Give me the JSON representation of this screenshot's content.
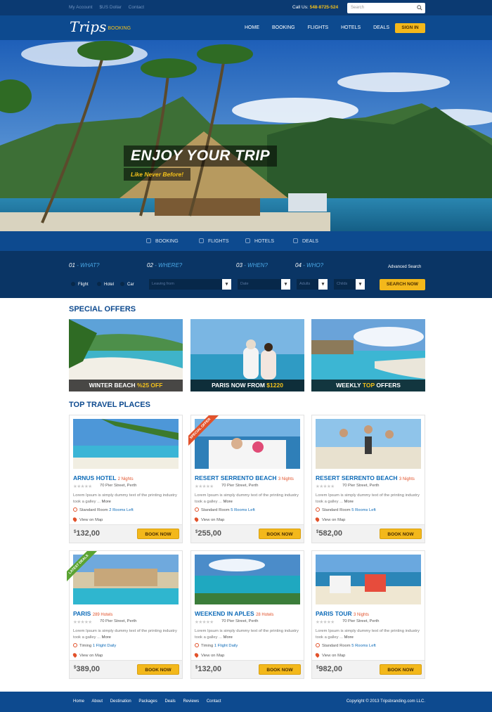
{
  "topbar": {
    "links": [
      "My Account",
      "$US Dollar",
      "Contact"
    ],
    "call_label": "Call Us:",
    "phone": "548-8725-524",
    "search_placeholder": "Search"
  },
  "header": {
    "logo": "Trips",
    "logo_sub": "BOOKING",
    "menu": [
      "HOME",
      "BOOKING",
      "FLIGHTS",
      "HOTELS",
      "DEALS"
    ],
    "signin": "SIGN IN"
  },
  "hero": {
    "title": "ENJOY YOUR TRIP",
    "subtitle": "Like Never Before!"
  },
  "tabs": [
    "BOOKING",
    "FLIGHTS",
    "HOTELS",
    "DEALS"
  ],
  "search_form": {
    "steps": [
      {
        "num": "01",
        "label": " - WHAT?"
      },
      {
        "num": "02",
        "label": " - WHERE?"
      },
      {
        "num": "03",
        "label": " - WHEN?"
      },
      {
        "num": "04",
        "label": " - WHO?"
      }
    ],
    "advanced": "Advanced Search",
    "types": [
      "Flight",
      "Hotel",
      "Car"
    ],
    "leaving_from": "Leaving from",
    "date": "Date",
    "adults": "Adults",
    "childs": "Childs",
    "button": "SEARCH NOW"
  },
  "special_offers": {
    "title": "SPECIAL OFFERS",
    "items": [
      {
        "pre": "WINTER BEACH ",
        "hl": "%25 OFF",
        "post": ""
      },
      {
        "pre": "PARIS NOW FROM ",
        "hl": "$1220",
        "post": ""
      },
      {
        "pre": "WEEKLY ",
        "hl": "TOP",
        "post": " OFFERS"
      }
    ]
  },
  "top_places": {
    "title": "TOP TRAVEL PLACES",
    "stars": "★★★★★",
    "desc": "Lorem Ipsum is simply dummy text of the printing industry took a galley ... ",
    "more": "More",
    "view_map": "View on Map",
    "book": "BOOK NOW",
    "currency": "$",
    "cards": [
      {
        "name": "ARNUS HOTEL",
        "nights": "2 Nights",
        "addr": "70 Pier Street, Perth",
        "room": "Standard Room",
        "room_hl": "2 Rooms Left",
        "price": "132,00",
        "ribbon": ""
      },
      {
        "name": "RESERT SERRENTO BEACH",
        "nights": "3 Nights",
        "addr": "70 Pier Street, Perth",
        "room": "Standard Room",
        "room_hl": "5 Rooms Left",
        "price": "255,00",
        "ribbon": "SPECIAL OFFER"
      },
      {
        "name": "RESERT SERRENTO BEACH",
        "nights": "3 Nights",
        "addr": "70 Pier Street, Perth",
        "room": "Standard Room",
        "room_hl": "5 Rooms Left",
        "price": "582,00",
        "ribbon": ""
      },
      {
        "name": "PARIS",
        "nights": "289 Hotels",
        "addr": "70 Pier Street, Perth",
        "room": "Timing",
        "room_hl": "1 Flight Daily",
        "price": "389,00",
        "ribbon": "LATEST DEALS"
      },
      {
        "name": "WEEKEND IN APLES",
        "nights": "28 Hotels",
        "addr": "70 Pier Street, Perth",
        "room": "Timing",
        "room_hl": "1 Flight Daily",
        "price": "132,00",
        "ribbon": ""
      },
      {
        "name": "PARIS TOUR",
        "nights": "3 Nights",
        "addr": "70 Pier Street, Perth",
        "room": "Standard Room",
        "room_hl": "5 Rooms Left",
        "price": "982,00",
        "ribbon": ""
      }
    ]
  },
  "footer": {
    "links": [
      "Home",
      "About",
      "Destination",
      "Packages",
      "Deals",
      "Reviews",
      "Contact"
    ],
    "copyright": "Copyright © 2013 Tripsbranding.com LLC."
  }
}
